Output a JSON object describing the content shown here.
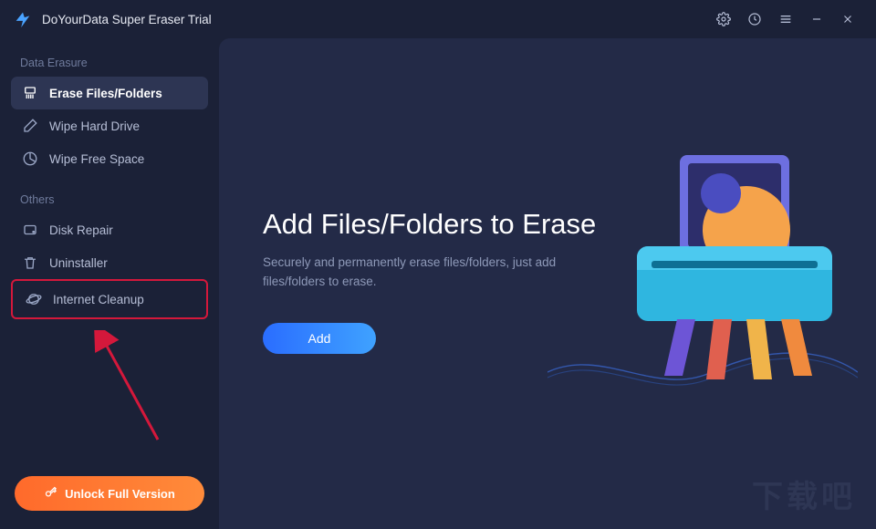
{
  "app": {
    "title": "DoYourData Super Eraser Trial"
  },
  "titlebar": {
    "settings_icon": "gear",
    "history_icon": "clock",
    "menu_icon": "menu",
    "minimize_icon": "minimize",
    "close_icon": "close"
  },
  "sidebar": {
    "group1_label": "Data Erasure",
    "group2_label": "Others",
    "items": [
      {
        "id": "erase-files",
        "label": "Erase Files/Folders",
        "active": true
      },
      {
        "id": "wipe-drive",
        "label": "Wipe Hard Drive",
        "active": false
      },
      {
        "id": "wipe-free",
        "label": "Wipe Free Space",
        "active": false
      },
      {
        "id": "disk-repair",
        "label": "Disk Repair",
        "active": false
      },
      {
        "id": "uninstaller",
        "label": "Uninstaller",
        "active": false
      },
      {
        "id": "internet-cleanup",
        "label": "Internet Cleanup",
        "active": false,
        "highlighted": true
      }
    ],
    "unlock_label": "Unlock Full Version"
  },
  "main": {
    "heading": "Add Files/Folders to Erase",
    "subtitle": "Securely and permanently erase files/folders, just add files/folders to erase.",
    "add_label": "Add"
  },
  "colors": {
    "bg": "#1b2137",
    "panel": "#232a47",
    "active": "#2d3553",
    "accent_orange": "#ff7a32",
    "accent_blue": "#3288ff",
    "highlight_red": "#d4183b"
  },
  "watermark": "下载吧"
}
